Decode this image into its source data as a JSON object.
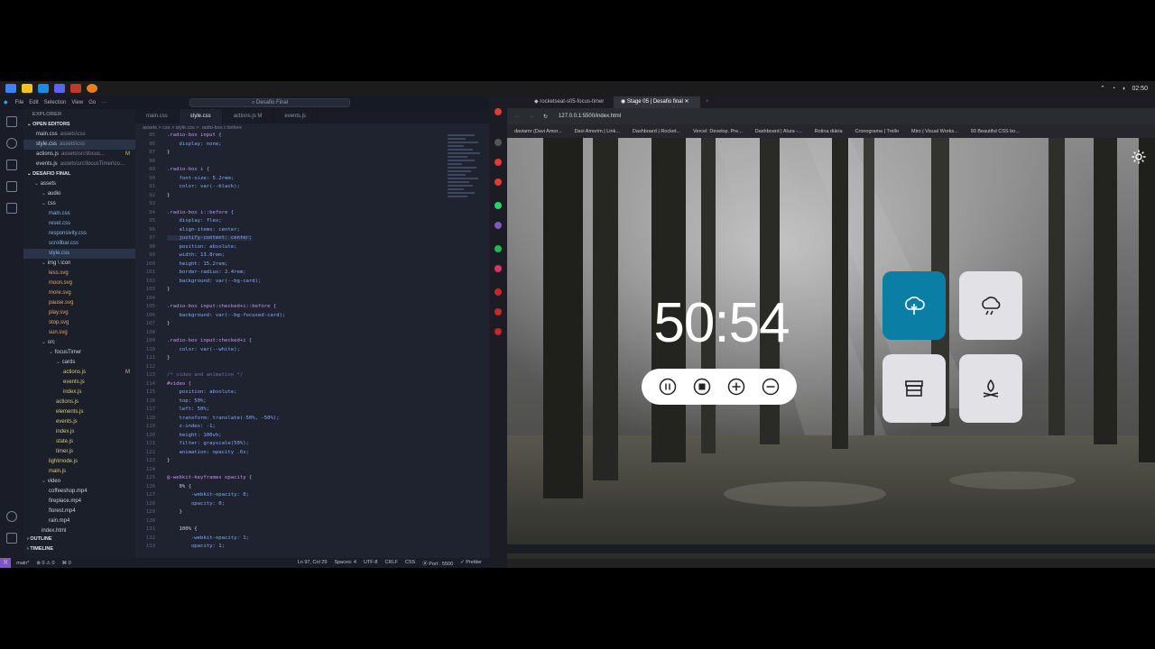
{
  "taskbar": {
    "time": "02:50"
  },
  "vscode": {
    "menu": [
      "File",
      "Edit",
      "Selection",
      "View",
      "Go",
      "···"
    ],
    "search": "Desafio Final",
    "explorer_title": "EXPLORER",
    "open_editors": "OPEN EDITORS",
    "open_files": [
      {
        "name": "main.css",
        "path": "assets\\css"
      },
      {
        "name": "style.css",
        "path": "assets\\css"
      },
      {
        "name": "actions.js",
        "path": "assets\\src\\focus...",
        "badge": "M"
      },
      {
        "name": "events.js",
        "path": "assets\\src\\focusTimer\\co..."
      }
    ],
    "project": "DESAFIO FINAL",
    "tree": [
      "assets",
      "audio",
      "css",
      "main.css",
      "reset.css",
      "responsivity.css",
      "scrollbar.css",
      "style.css",
      "img \\ icon",
      "less.svg",
      "moon.svg",
      "more.svg",
      "pause.svg",
      "play.svg",
      "stop.svg",
      "sun.svg",
      "src",
      "focusTimer",
      "cards",
      "actions.js",
      "events.js",
      "index.js",
      "actions.js",
      "elements.js",
      "events.js",
      "index.js",
      "state.js",
      "timer.js",
      "lightmode.js",
      "main.js",
      "video",
      "coffeeshop.mp4",
      "fireplace.mp4",
      "florest.mp4",
      "rain.mp4",
      "index.html"
    ],
    "outline": "OUTLINE",
    "timeline": "TIMELINE",
    "tabs": [
      "main.css",
      "style.css",
      "actions.js M",
      "events.js"
    ],
    "breadcrumb": "assets > css > style.css > .radio-box i::before",
    "line_numbers": [
      "85",
      "86",
      "87",
      "88",
      "89",
      "90",
      "91",
      "92",
      "93",
      "94",
      "95",
      "96",
      "97",
      "98",
      "99",
      "100",
      "101",
      "102",
      "103",
      "104",
      "105",
      "106",
      "107",
      "108",
      "109",
      "110",
      "111",
      "112",
      "113",
      "114",
      "115",
      "116",
      "117",
      "118",
      "119",
      "120",
      "121",
      "122",
      "123",
      "124",
      "125",
      "126",
      "127",
      "128",
      "129",
      "130",
      "131",
      "132",
      "133"
    ],
    "code": [
      ".radio-box input {",
      "    display: none;",
      "}",
      "",
      ".radio-box i {",
      "    font-size: 5.2rem;",
      "    color: var(--black);",
      "}",
      "",
      ".radio-box i::before {",
      "    display: flex;",
      "    align-items: center;",
      "    justify-content: center;",
      "    position: absolute;",
      "    width: 13.8rem;",
      "    height: 15.2rem;",
      "    border-radius: 2.4rem;",
      "    background: var(--bg-card);",
      "}",
      "",
      ".radio-box input:checked+i::before {",
      "    background: var(--bg-focused-card);",
      "}",
      "",
      ".radio-box input:checked+i {",
      "    color: var(--white);",
      "}",
      "",
      "/* video and animation */",
      "#video {",
      "    position: absolute;",
      "    top: 50%;",
      "    left: 50%;",
      "    transform: translate(-50%, -50%);",
      "    z-index: -1;",
      "    height: 100vh;",
      "    filter: grayscale(50%);",
      "    animation: opacity .6s;",
      "}",
      "",
      "@-webkit-keyframes opacity {",
      "    0% {",
      "        -webkit-opacity: 0;",
      "        opacity: 0;",
      "    }",
      "",
      "    100% {",
      "        -webkit-opacity: 1;",
      "        opacity: 1;"
    ],
    "status_left": "main*",
    "status_errors": "⊗ 0 ⚠ 0",
    "status_ports": "⌘ 0",
    "status_right": [
      "Ln 97, Col 29",
      "Spaces: 4",
      "UTF-8",
      "CRLF",
      "CSS",
      "⦿ Port : 5500",
      "✓ Prettier"
    ]
  },
  "browser": {
    "tabs": [
      "rocketseat-s05-focus-timer",
      "Stage 05 | Desafio final"
    ],
    "url": "127.0.0.1:5500/index.html",
    "bookmarks": [
      "daviamr (Davi Amor...",
      "Davi Amorim | Link...",
      "Dashboard | Rocket...",
      "Vercel: Develop. Pre...",
      "Dashboard | Alura -...",
      "Rotina diária",
      "Cronograma | Trello",
      "Miro | Visual Works...",
      "93 Beautiful CSS bo..."
    ],
    "timer": "50:54",
    "cards": [
      {
        "icon": "tree-icon",
        "active": true
      },
      {
        "icon": "cloud-rain-icon",
        "active": false
      },
      {
        "icon": "store-icon",
        "active": false
      },
      {
        "icon": "campfire-icon",
        "active": false
      }
    ],
    "colors": {
      "active_card": "#0a7ea4",
      "card": "#e1e1e6"
    }
  }
}
